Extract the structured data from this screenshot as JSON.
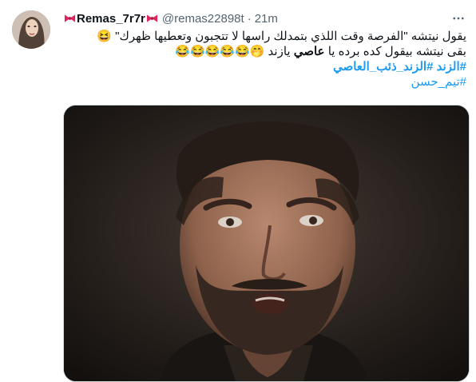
{
  "tweet": {
    "display_name": "Remas_7r7r",
    "handle": "@remas22898t",
    "separator": "·",
    "time": "21m",
    "lines": [
      "يقول نيتشه \"الفرصة وقت اللذي بتمدلك راسها لا تتجبون وتعطيها ظهرك\"",
      "بقى نيتشه بيقول كده برده يا",
      "عاصي",
      "يازند"
    ],
    "emojis": {
      "line1": "😆",
      "line2": "🤭😂😂😂😂😂"
    },
    "hashtags": [
      "#الزند",
      "#الزند_ذئب_العاصي",
      "#تيم_حسن"
    ]
  },
  "colors": {
    "link": "#1d9bf0",
    "text": "#0f1419",
    "muted": "#536471",
    "border": "#cfd9de"
  },
  "icons": {
    "more": "more-icon",
    "bow": "bow-icon",
    "avatar": "avatar"
  }
}
